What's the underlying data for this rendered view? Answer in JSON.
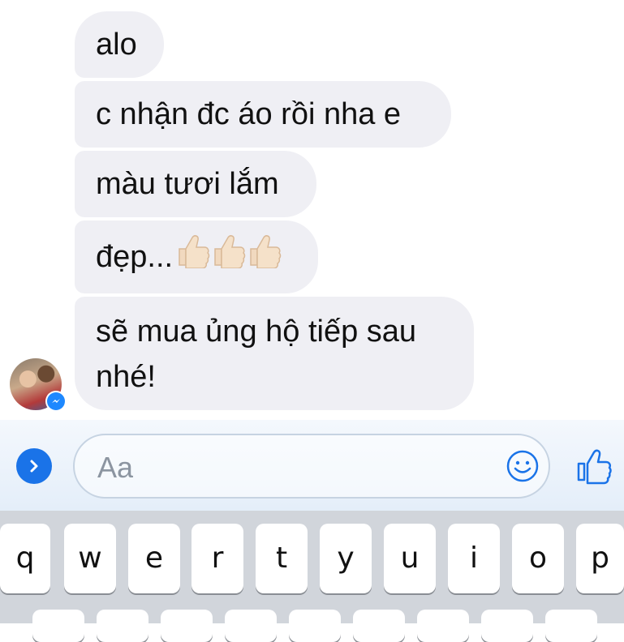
{
  "messages": [
    {
      "text": "alo"
    },
    {
      "text": "c nhận đc áo rồi nha e"
    },
    {
      "text": "màu tươi lắm"
    },
    {
      "text": "đẹp...",
      "emoji": [
        "thumbs-up-icon",
        "thumbs-up-icon",
        "thumbs-up-icon"
      ]
    },
    {
      "text": "sẽ mua ủng hộ tiếp sau nhé!"
    }
  ],
  "composer": {
    "placeholder": "Aa",
    "expand_icon": "chevron-right-icon",
    "emoji_icon": "smiley-icon",
    "like_icon": "thumbs-up-icon"
  },
  "keyboard": {
    "row1": [
      "q",
      "w",
      "e",
      "r",
      "t",
      "y",
      "u",
      "i",
      "o",
      "p"
    ]
  },
  "colors": {
    "bubble": "#efeff4",
    "accent": "#1a73e8",
    "messenger_badge": "#1e88ff"
  }
}
